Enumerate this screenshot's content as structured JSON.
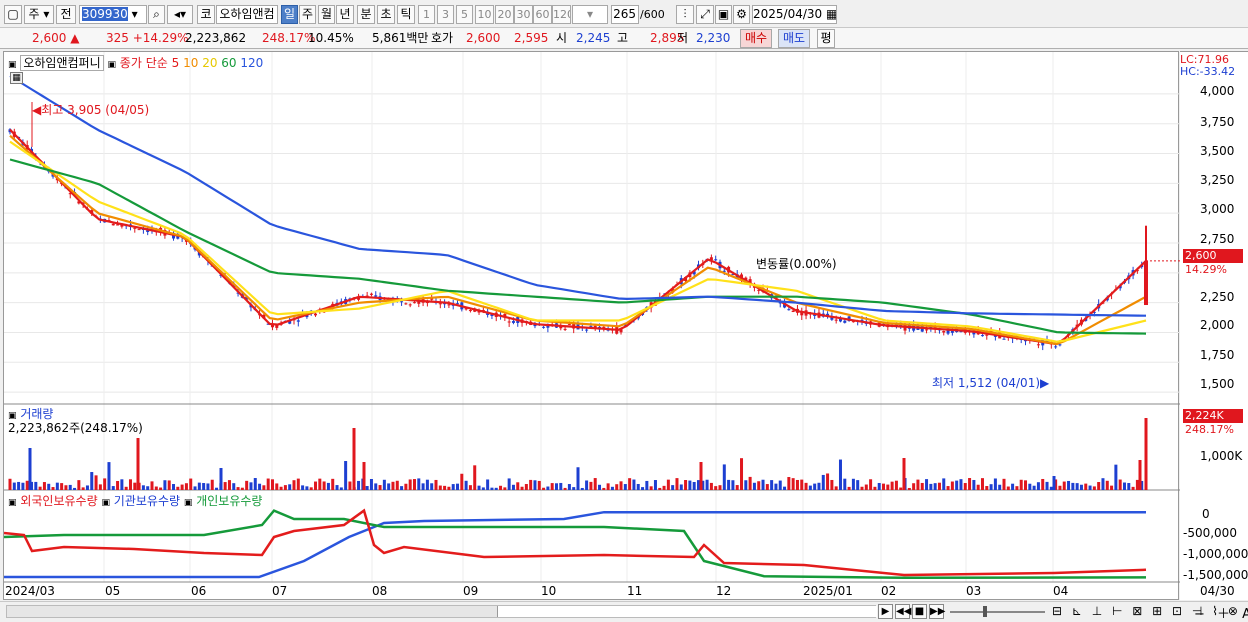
{
  "toolbar": {
    "market": "주",
    "mode": "전",
    "code": "309930",
    "market_btn": "코",
    "name": "오하임앤컴",
    "periods": [
      "일",
      "주",
      "월",
      "년",
      "분",
      "초",
      "틱"
    ],
    "nums": [
      "1",
      "3",
      "5",
      "10",
      "20",
      "30",
      "60",
      "120"
    ],
    "count": "265",
    "count_total": "/600",
    "date": "2025/04/30"
  },
  "quote": {
    "price": "2,600",
    "arrow": "▲",
    "change": "325",
    "change_pct": "+14.29%",
    "volume": "2,223,862",
    "vol_pct": "248.17%",
    "turnover": "10.45%",
    "amount": "5,861백만",
    "hoga_label": "호가",
    "ask": "2,600",
    "bid": "2,595",
    "open_label": "시",
    "open": "2,245",
    "high_label": "고",
    "high": "2,895",
    "low_label": "저",
    "low": "2,230",
    "buy_btn": "매수",
    "sell_btn": "매도",
    "eval_btn": "평"
  },
  "chart": {
    "legend_name": "오하임앤컴퍼니",
    "legend_ma": "종가 단순",
    "ma_periods": [
      "5",
      "10",
      "20",
      "60",
      "120"
    ],
    "lc": "LC:71.96",
    "hc": "HC:-33.42",
    "price_ticks": [
      "4,000",
      "3,750",
      "3,500",
      "3,250",
      "3,000",
      "2,750",
      "2,500",
      "2,250",
      "2,000",
      "1,750",
      "1,500"
    ],
    "price_tag": "2,600",
    "price_tag_pct": "14.29%",
    "high_note": "최고 3,905 (04/05)",
    "low_note": "최저 1,512 (04/01)",
    "mid_note": "변동률(0.00%)",
    "volume_title": "거래량",
    "volume_value": "2,223,862주(248.17%)",
    "volume_tick": "1,000K",
    "volume_tag": "2,224K",
    "volume_tag_pct": "248.17%",
    "holder_legend": [
      "외국인보유수량",
      "기관보유수량",
      "개인보유수량"
    ],
    "holder_ticks": [
      "0",
      "-500,000",
      "-1,000,000",
      "-1,500,000"
    ],
    "x_labels": [
      "2024/03",
      "05",
      "06",
      "07",
      "08",
      "09",
      "10",
      "11",
      "12",
      "2025/01",
      "02",
      "03",
      "04"
    ],
    "x_end": "04/30",
    "colors": {
      "ma5": "#e31c1c",
      "ma10": "#f08c00",
      "ma20": "#ffe11a",
      "ma60": "#159a3a",
      "ma120": "#2a55dd",
      "up": "#e0171e",
      "down": "#1d3fd1"
    }
  },
  "chart_data": {
    "type": "line",
    "title": "오하임앤컴퍼니",
    "x": [
      "2024/03",
      "05",
      "06",
      "07",
      "08",
      "09",
      "10",
      "11",
      "12",
      "2025/01",
      "02",
      "03",
      "04",
      "04/30"
    ],
    "series": [
      {
        "name": "5",
        "values": [
          3700,
          2950,
          2800,
          2050,
          2300,
          2250,
          2070,
          2020,
          2620,
          2180,
          2060,
          2010,
          1900,
          2600
        ]
      },
      {
        "name": "10",
        "values": [
          3650,
          3000,
          2800,
          2100,
          2250,
          2300,
          2100,
          2050,
          2550,
          2250,
          2080,
          2030,
          1900,
          2300
        ]
      },
      {
        "name": "20",
        "values": [
          3600,
          3100,
          2820,
          2150,
          2200,
          2350,
          2100,
          2100,
          2450,
          2350,
          2100,
          2050,
          1920,
          2100
        ]
      },
      {
        "name": "60",
        "values": [
          3450,
          3250,
          2850,
          2500,
          2450,
          2350,
          2300,
          2250,
          2300,
          2300,
          2250,
          2150,
          2000,
          1990
        ]
      },
      {
        "name": "120",
        "values": [
          4150,
          3700,
          3350,
          2900,
          2700,
          2650,
          2400,
          2280,
          2300,
          2250,
          2180,
          2160,
          2150,
          2140
        ]
      }
    ],
    "ylim": [
      1400,
      4100
    ]
  }
}
